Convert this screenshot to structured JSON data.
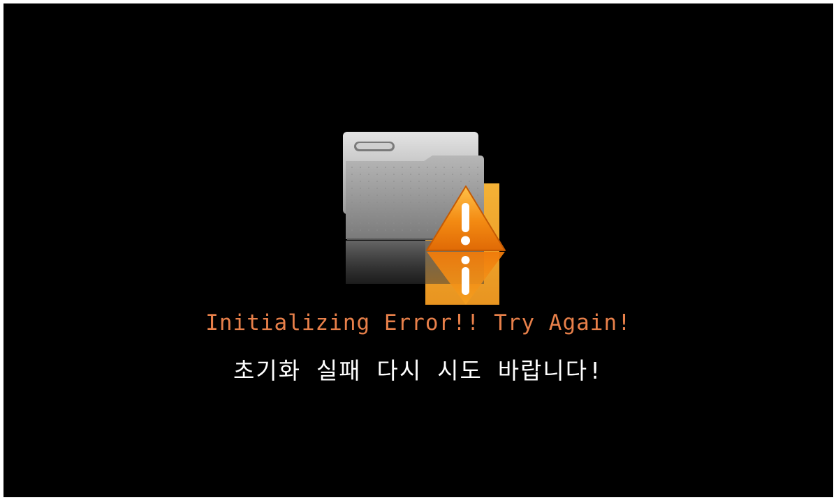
{
  "dialog": {
    "icon": "folder-warning-icon",
    "message_en": "Initializing Error!! Try Again!",
    "message_ko": "초기화 실패 다시 시도 바랍니다!"
  },
  "colors": {
    "background": "#000000",
    "message_en": "#e8804a",
    "message_ko": "#ffffff",
    "warning": "#f08a12"
  }
}
